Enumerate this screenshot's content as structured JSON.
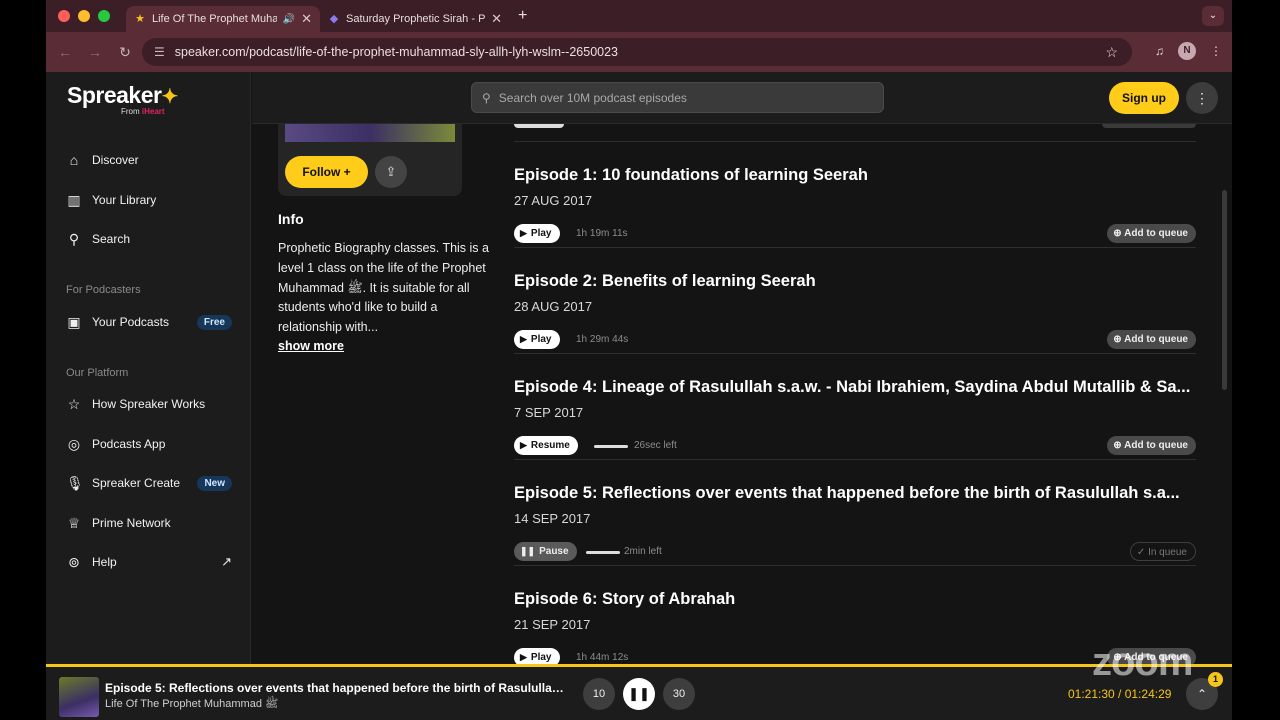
{
  "browser": {
    "tabs": [
      {
        "title": "Life Of The Prophet Muha",
        "active": true,
        "favicon": "spreaker-star-icon"
      },
      {
        "title": "Saturday Prophetic Sirah - Pr",
        "active": false,
        "favicon": "shield-icon"
      }
    ],
    "url": "speaker.com/podcast/life-of-the-prophet-muhammad-sly-allh-lyh-wslm--2650023",
    "profile_initial": "N"
  },
  "brand": {
    "name": "Spreaker",
    "sub_from": "From",
    "sub_brand": "iHeart",
    "accent": "#ffcc1a"
  },
  "sidebar": {
    "items": [
      {
        "label": "Discover",
        "icon": "home-icon"
      },
      {
        "label": "Your Library",
        "icon": "library-icon"
      },
      {
        "label": "Search",
        "icon": "search-icon"
      }
    ],
    "podcasters_label": "For Podcasters",
    "podcasters_items": [
      {
        "label": "Your Podcasts",
        "icon": "podcast-icon",
        "badge": "Free"
      }
    ],
    "platform_label": "Our Platform",
    "platform_items": [
      {
        "label": "How Spreaker Works",
        "icon": "star-icon"
      },
      {
        "label": "Podcasts App",
        "icon": "app-icon"
      },
      {
        "label": "Spreaker Create",
        "icon": "mic-icon",
        "badge": "New"
      },
      {
        "label": "Prime Network",
        "icon": "crown-icon"
      },
      {
        "label": "Help",
        "icon": "help-icon"
      }
    ]
  },
  "header": {
    "search_placeholder": "Search over 10M podcast episodes",
    "signup_label": "Sign up"
  },
  "show": {
    "follow_label": "Follow +",
    "info_title": "Info",
    "info_text": "Prophetic Biography classes. This is a level 1 class on the life of the Prophet Muhammad ﷺ. It is suitable for all students who'd like to build a relationship with...",
    "show_more": "show more"
  },
  "episodes": [
    {
      "title": "Episode 1: 10 foundations of learning Seerah",
      "date": "27 AUG 2017",
      "action": "Play",
      "meta": "1h 19m 11s",
      "queue": "Add to queue",
      "state": "play"
    },
    {
      "title": "Episode 2: Benefits of learning Seerah",
      "date": "28 AUG 2017",
      "action": "Play",
      "meta": "1h 29m 44s",
      "queue": "Add to queue",
      "state": "play"
    },
    {
      "title": "Episode 4: Lineage of Rasulullah s.a.w. - Nabi Ibrahiem, Saydina Abdul Mutallib & Sa...",
      "date": "7 SEP 2017",
      "action": "Resume",
      "meta": "26sec left",
      "queue": "Add to queue",
      "state": "resume"
    },
    {
      "title": "Episode 5: Reflections over events that happened before the birth of Rasulullah s.a...",
      "date": "14 SEP 2017",
      "action": "Pause",
      "meta": "2min left",
      "queue": "In queue",
      "state": "pause"
    },
    {
      "title": "Episode 6: Story of Abrahah",
      "date": "21 SEP 2017",
      "action": "Play",
      "meta": "1h 44m 12s",
      "queue": "Add to queue",
      "state": "play"
    }
  ],
  "player": {
    "title": "Episode 5: Reflections over events that happened before the birth of Rasulullah...",
    "subtitle": "Life Of The Prophet Muhammad ﷺ",
    "elapsed_total": "01:21:30 / 01:24:29",
    "queue_count": "1",
    "skip_back": "10",
    "skip_fwd": "30"
  },
  "watermark": "zoom"
}
